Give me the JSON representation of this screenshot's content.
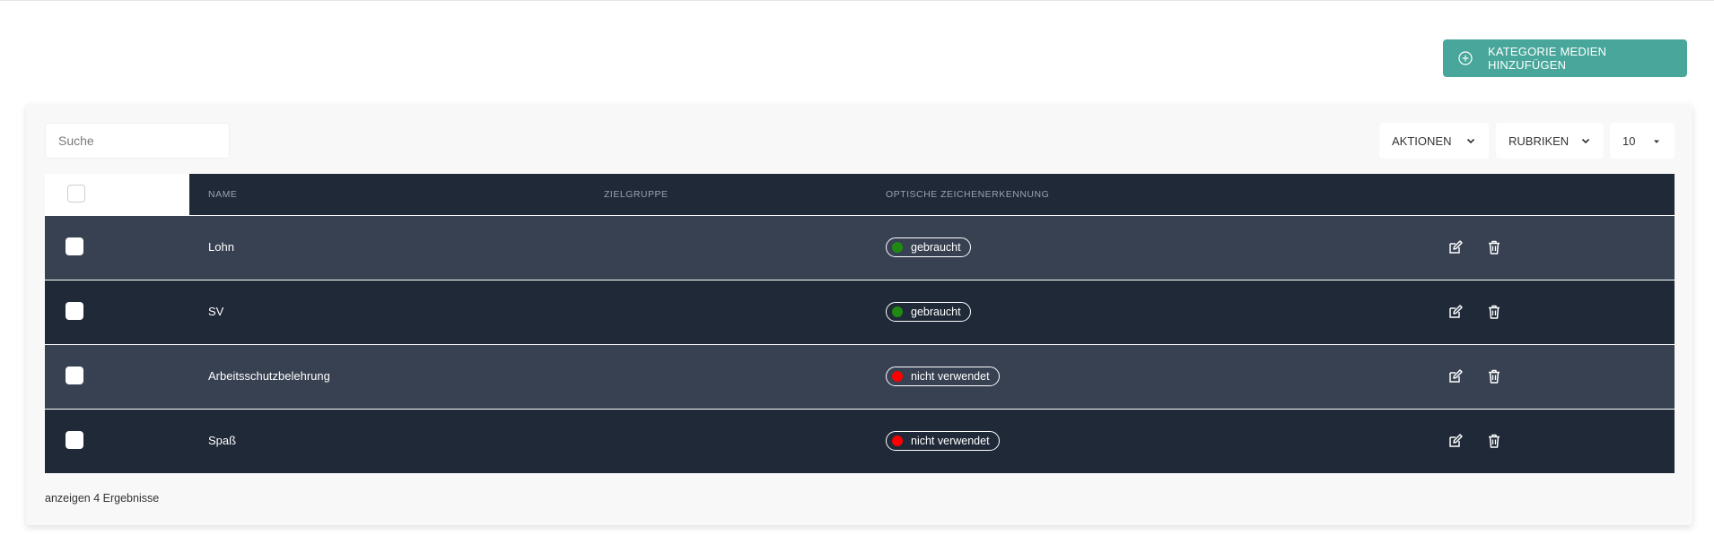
{
  "header": {
    "add_button_label": "KATEGORIE MEDIEN HINZUFÜGEN",
    "add_icon": "plus-circle-icon"
  },
  "toolbar": {
    "search_placeholder": "Suche",
    "actions_label": "AKTIONEN",
    "categories_label": "RUBRIKEN",
    "page_size": "10"
  },
  "table": {
    "columns": [
      "NAME",
      "ZIELGRUPPE",
      "OPTISCHE ZEICHENERKENNUNG"
    ],
    "rows": [
      {
        "name": "Lohn",
        "target_group": "",
        "status": "gebraucht",
        "status_color": "#1f8a12"
      },
      {
        "name": "SV",
        "target_group": "",
        "status": "gebraucht",
        "status_color": "#1f8a12"
      },
      {
        "name": "Arbeitsschutzbelehrung",
        "target_group": "",
        "status": "nicht verwendet",
        "status_color": "#ff0000"
      },
      {
        "name": "Spaß",
        "target_group": "",
        "status": "nicht verwendet",
        "status_color": "#ff0000"
      }
    ],
    "row_actions": [
      "edit-icon",
      "trash-icon"
    ]
  },
  "footer": {
    "results_text": "anzeigen 4 Ergebnisse"
  },
  "colors": {
    "accent": "#48a79a",
    "table_header": "#1f2937",
    "row_light": "#374151",
    "row_dark": "#1f2937"
  }
}
